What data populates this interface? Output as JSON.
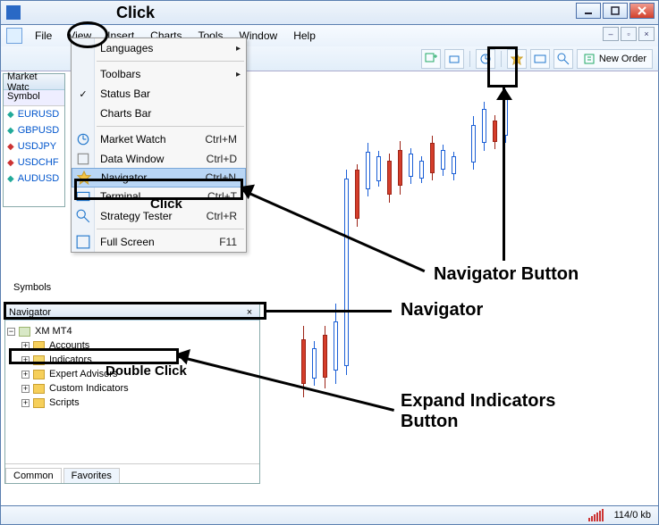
{
  "menubar": {
    "items": [
      "File",
      "View",
      "Insert",
      "Charts",
      "Tools",
      "Window",
      "Help"
    ]
  },
  "toolbar": {
    "new_order": "New Order"
  },
  "view_menu": {
    "languages": "Languages",
    "toolbars": "Toolbars",
    "status_bar": "Status Bar",
    "charts_bar": "Charts Bar",
    "market_watch": "Market Watch",
    "market_watch_kbd": "Ctrl+M",
    "data_window": "Data Window",
    "data_window_kbd": "Ctrl+D",
    "navigator": "Navigator",
    "navigator_kbd": "Ctrl+N",
    "terminal": "Terminal",
    "terminal_kbd": "Ctrl+T",
    "strategy_tester": "Strategy Tester",
    "strategy_tester_kbd": "Ctrl+R",
    "full_screen": "Full Screen",
    "full_screen_kbd": "F11"
  },
  "market_watch": {
    "title": "Market Watc",
    "col_symbol": "Symbol",
    "rows": [
      "EURUSD",
      "GBPUSD",
      "USDJPY",
      "USDCHF",
      "AUDUSD"
    ],
    "symbols_label": "Symbols"
  },
  "navigator": {
    "title": "Navigator",
    "root": "XM MT4",
    "items": [
      "Accounts",
      "Indicators",
      "Expert Advisors",
      "Custom Indicators",
      "Scripts"
    ],
    "tab_common": "Common",
    "tab_favorites": "Favorites"
  },
  "status": {
    "speed": "114/0 kb"
  },
  "annotations": {
    "click_top": "Click",
    "click_nav": "Click",
    "double_click": "Double Click",
    "navigator_button": "Navigator Button",
    "navigator": "Navigator",
    "expand_indicators": "Expand Indicators\nButton"
  }
}
